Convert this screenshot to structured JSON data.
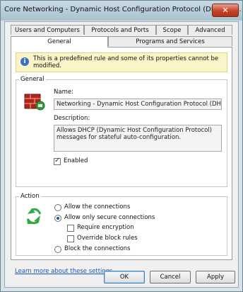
{
  "window": {
    "title": "Core Networking - Dynamic Host Configuration Protocol (DHCP-In...",
    "close_glyph": "✕"
  },
  "tabs_row1": [
    "Users and Computers",
    "Protocols and Ports",
    "Scope",
    "Advanced"
  ],
  "tabs_row2": [
    "General",
    "Programs and Services"
  ],
  "info": {
    "icon": "info-icon",
    "glyph": "i",
    "text": "This is a predefined rule and some of its properties cannot be modified."
  },
  "general": {
    "group_title": "General",
    "name_label": "Name:",
    "name_value": "Networking - Dynamic Host Configuration Protocol (DHCP-In)",
    "description_label": "Description:",
    "description_value": "Allows DHCP (Dynamic Host Configuration Protocol) messages for stateful auto-configuration.",
    "enabled_label": "Enabled"
  },
  "action": {
    "group_title": "Action",
    "allow_label": "Allow the connections",
    "secure_label": "Allow only secure connections",
    "require_label": "Require encryption",
    "override_label": "Override block rules",
    "block_label": "Block the connections"
  },
  "link_text": "Learn more about these settings",
  "buttons": {
    "ok": "OK",
    "cancel": "Cancel",
    "apply": "Apply"
  }
}
